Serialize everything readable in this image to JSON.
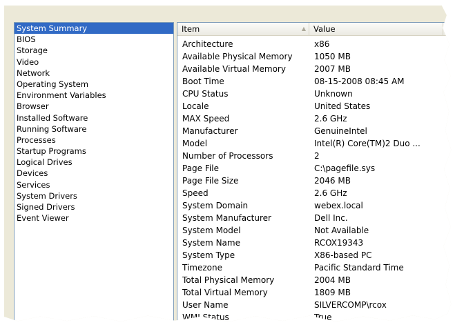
{
  "nav": {
    "items": [
      {
        "label": "System Summary",
        "selected": true
      },
      {
        "label": "BIOS"
      },
      {
        "label": "Storage"
      },
      {
        "label": "Video"
      },
      {
        "label": "Network"
      },
      {
        "label": "Operating System"
      },
      {
        "label": "Environment Variables"
      },
      {
        "label": "Browser"
      },
      {
        "label": "Installed Software"
      },
      {
        "label": "Running Software"
      },
      {
        "label": "Processes"
      },
      {
        "label": "Startup Programs"
      },
      {
        "label": "Logical Drives"
      },
      {
        "label": "Devices"
      },
      {
        "label": "Services"
      },
      {
        "label": "System Drivers"
      },
      {
        "label": "Signed Drivers"
      },
      {
        "label": "Event Viewer"
      }
    ]
  },
  "table": {
    "headers": {
      "item": "Item",
      "value": "Value"
    },
    "rows": [
      {
        "item": "Architecture",
        "value": "x86"
      },
      {
        "item": "Available Physical Memory",
        "value": "1050 MB"
      },
      {
        "item": "Available Virtual Memory",
        "value": "2007 MB"
      },
      {
        "item": "Boot Time",
        "value": "08-15-2008 08:45 AM"
      },
      {
        "item": "CPU Status",
        "value": "Unknown"
      },
      {
        "item": "Locale",
        "value": "United States"
      },
      {
        "item": "MAX Speed",
        "value": "2.6 GHz"
      },
      {
        "item": "Manufacturer",
        "value": "GenuineIntel"
      },
      {
        "item": "Model",
        "value": "Intel(R) Core(TM)2 Duo ..."
      },
      {
        "item": "Number of Processors",
        "value": "2"
      },
      {
        "item": "Page File",
        "value": "C:\\pagefile.sys"
      },
      {
        "item": "Page File Size",
        "value": "2046 MB"
      },
      {
        "item": "Speed",
        "value": "2.6 GHz"
      },
      {
        "item": "System Domain",
        "value": "webex.local"
      },
      {
        "item": "System Manufacturer",
        "value": "Dell Inc."
      },
      {
        "item": "System Model",
        "value": "Not Available"
      },
      {
        "item": "System Name",
        "value": "RCOX19343"
      },
      {
        "item": "System Type",
        "value": "X86-based PC"
      },
      {
        "item": "Timezone",
        "value": "Pacific Standard Time"
      },
      {
        "item": "Total Physical Memory",
        "value": "2004 MB"
      },
      {
        "item": "Total Virtual Memory",
        "value": "1809 MB"
      },
      {
        "item": "User Name",
        "value": "SILVERCOMP\\rcox"
      },
      {
        "item": "WMI Status",
        "value": "True"
      }
    ]
  },
  "colors": {
    "selection": "#316ac5",
    "pane_border": "#7f9db9",
    "window_bg": "#ece9d8"
  }
}
